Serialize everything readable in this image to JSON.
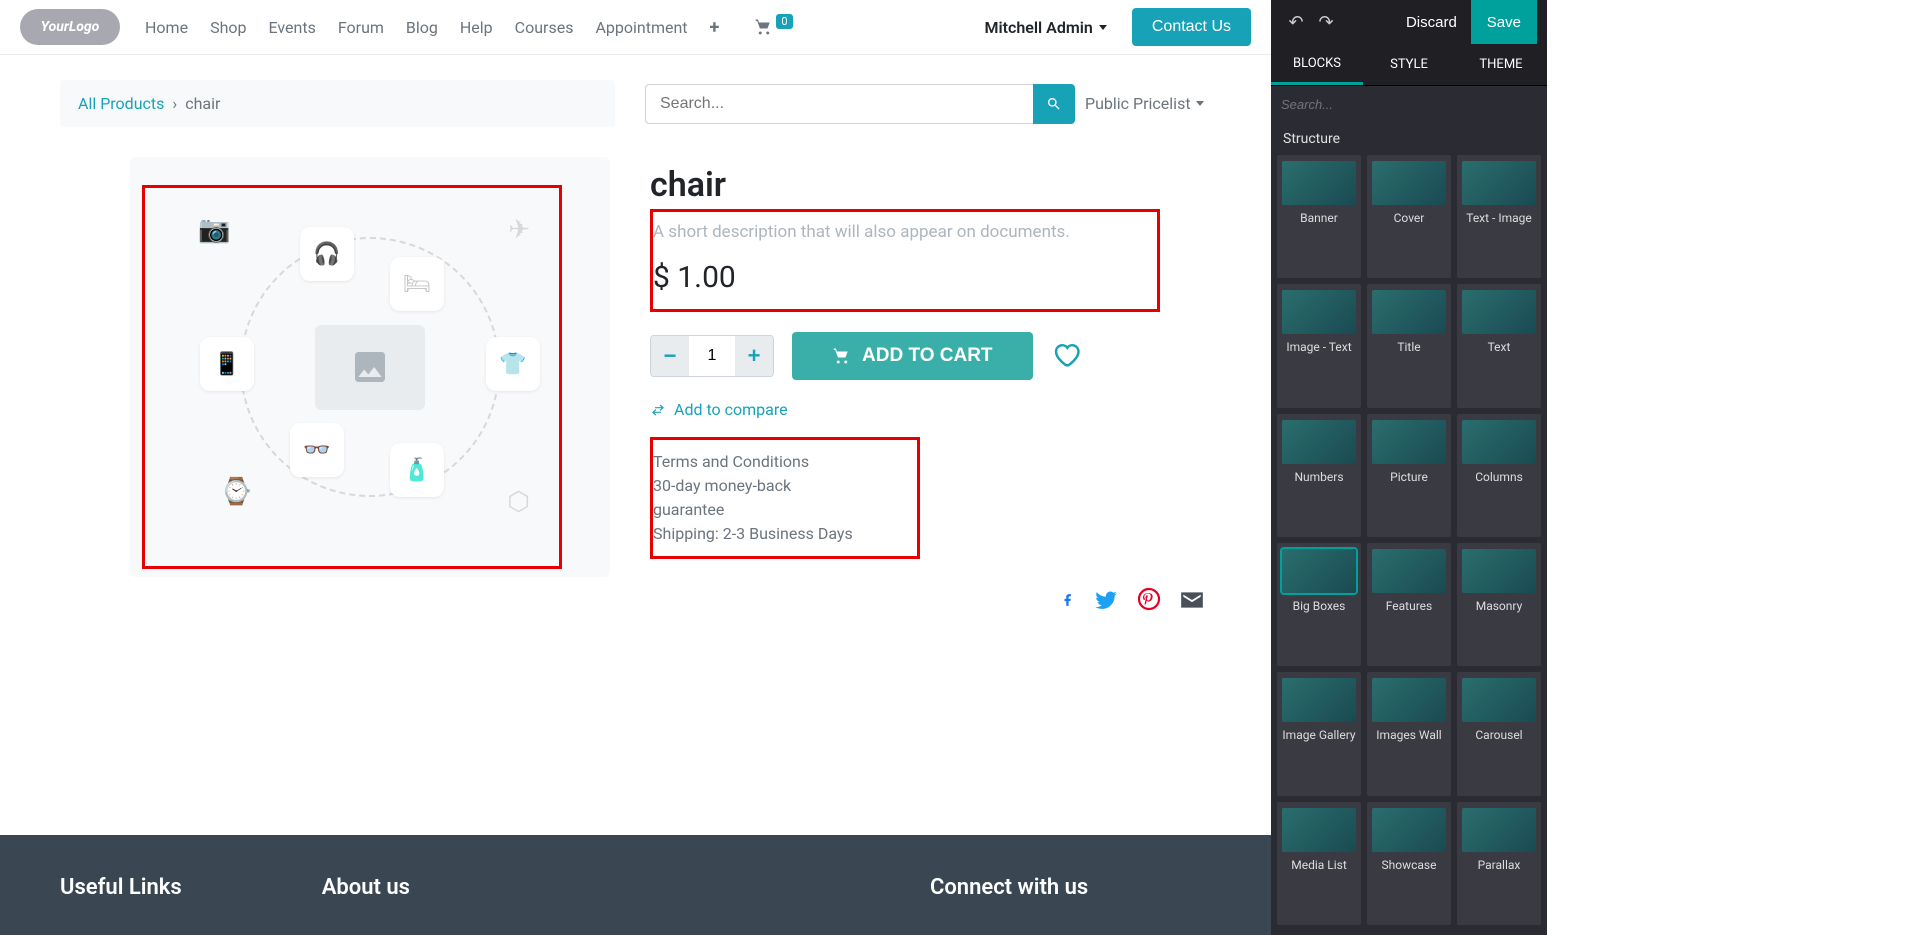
{
  "logo_text": "YourLogo",
  "nav": {
    "items": [
      "Home",
      "Shop",
      "Events",
      "Forum",
      "Blog",
      "Help",
      "Courses",
      "Appointment"
    ]
  },
  "cart_count": "0",
  "user_name": "Mitchell Admin",
  "contact_btn": "Contact Us",
  "breadcrumb": {
    "root": "All Products",
    "current": "chair"
  },
  "search": {
    "placeholder": "Search..."
  },
  "pricelist": "Public Pricelist",
  "product": {
    "title": "chair",
    "description_placeholder": "A short description that will also appear on documents.",
    "price": "$ 1.00",
    "quantity": "1",
    "add_to_cart": "ADD TO CART",
    "add_to_compare": "Add to compare",
    "terms_heading": "Terms and Conditions",
    "terms_line1": "30-day money-back guarantee",
    "terms_line2": "Shipping: 2-3 Business Days"
  },
  "footer": {
    "col1": "Useful Links",
    "col2": "About us",
    "col3": "Connect with us"
  },
  "editor": {
    "discard": "Discard",
    "save": "Save",
    "tabs": [
      "BLOCKS",
      "STYLE",
      "THEME"
    ],
    "search_placeholder": "Search...",
    "section": "Structure",
    "blocks": [
      "Banner",
      "Cover",
      "Text - Image",
      "Image - Text",
      "Title",
      "Text",
      "Numbers",
      "Picture",
      "Columns",
      "Big Boxes",
      "Features",
      "Masonry",
      "Image Gallery",
      "Images Wall",
      "Carousel",
      "Media List",
      "Showcase",
      "Parallax"
    ]
  }
}
